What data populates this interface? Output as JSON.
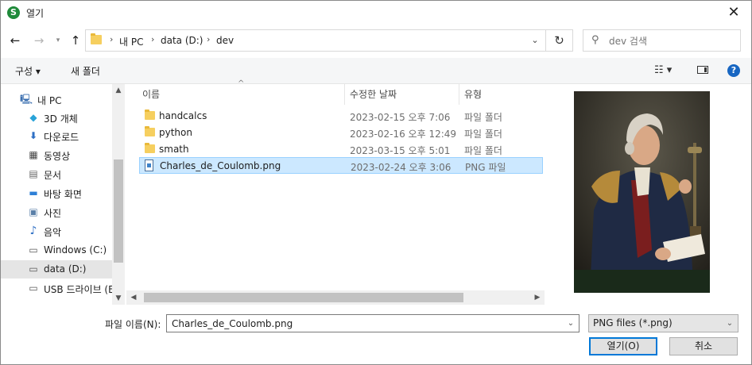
{
  "window": {
    "title": "열기",
    "app_icon_letter": "S"
  },
  "nav": {
    "crumbs": [
      "내 PC",
      "data (D:)",
      "dev"
    ],
    "search_placeholder": "dev 검색"
  },
  "toolbar": {
    "organize": "구성 ▾",
    "new_folder": "새 폴더"
  },
  "tree": {
    "items": [
      {
        "label": "내 PC",
        "icon": "monitor-icon"
      },
      {
        "label": "3D 개체",
        "icon": "cube-icon"
      },
      {
        "label": "다운로드",
        "icon": "download-icon"
      },
      {
        "label": "동영상",
        "icon": "film-icon"
      },
      {
        "label": "문서",
        "icon": "document-icon"
      },
      {
        "label": "바탕 화면",
        "icon": "desktop-icon"
      },
      {
        "label": "사진",
        "icon": "picture-icon"
      },
      {
        "label": "음악",
        "icon": "music-icon"
      },
      {
        "label": "Windows (C:)",
        "icon": "drive-icon"
      },
      {
        "label": "data (D:)",
        "icon": "drive-icon"
      },
      {
        "label": "USB 드라이브 (E",
        "icon": "usb-drive-icon"
      }
    ]
  },
  "list": {
    "headers": {
      "name": "이름",
      "date": "수정한 날짜",
      "type": "유형"
    },
    "rows": [
      {
        "name": "handcalcs",
        "date": "2023-02-15 오후 7:06",
        "type": "파일 폴더",
        "icon": "folder-icon"
      },
      {
        "name": "python",
        "date": "2023-02-16 오후 12:49",
        "type": "파일 폴더",
        "icon": "folder-icon"
      },
      {
        "name": "smath",
        "date": "2023-03-15 오후 5:01",
        "type": "파일 폴더",
        "icon": "folder-icon"
      },
      {
        "name": "Charles_de_Coulomb.png",
        "date": "2023-02-24 오후 3:06",
        "type": "PNG 파일",
        "icon": "image-file-icon"
      }
    ]
  },
  "bottom": {
    "filename_label": "파일 이름(N):",
    "filename_value": "Charles_de_Coulomb.png",
    "filetype_value": "PNG files (*.png)",
    "open_label": "열기(O)",
    "cancel_label": "취소"
  },
  "colors": {
    "accent": "#0078d7",
    "selection": "#cce8ff",
    "folder": "#f6cf5f"
  }
}
